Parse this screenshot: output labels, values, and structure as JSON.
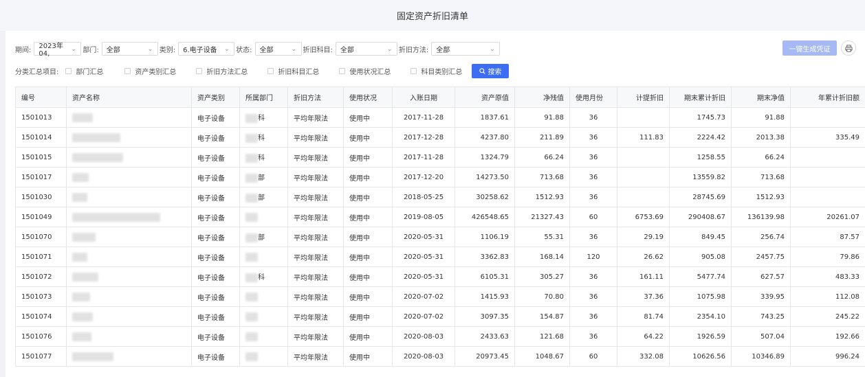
{
  "title": "固定资产折旧清单",
  "filters": {
    "period_label": "期间:",
    "period_value": "2023年04,",
    "dept_label": "部门:",
    "dept_value": "全部",
    "category_label": "类别:",
    "category_value": "6.电子设备",
    "status_label": "状态:",
    "status_value": "全部",
    "subject_label": "折旧科目:",
    "subject_value": "全部",
    "method_label": "折旧方法:",
    "method_value": "全部"
  },
  "buttons": {
    "generate": "一键生成凭证",
    "search": "搜索"
  },
  "summary": {
    "label": "分类汇总项目:",
    "options": [
      "部门汇总",
      "资产类别汇总",
      "折旧方法汇总",
      "折旧科目汇总",
      "使用状况汇总",
      "科目类别汇总"
    ]
  },
  "table": {
    "columns": [
      "编号",
      "资产名称",
      "资产类别",
      "所属部门",
      "折旧方法",
      "使用状况",
      "入账日期",
      "资产原值",
      "净残值",
      "使用月份",
      "计提折旧",
      "期末累计折旧",
      "期末净值",
      "年累计折旧额"
    ],
    "rows": [
      {
        "id": "1501013",
        "name_suffix": "",
        "category": "电子设备",
        "dept_suffix": "科",
        "method": "平均年限法",
        "status": "使用中",
        "date": "2017-11-28",
        "original": "1837.61",
        "residual": "91.88",
        "months": "36",
        "depr": "",
        "acc": "1745.73",
        "net": "91.88",
        "year": ""
      },
      {
        "id": "1501014",
        "name_suffix": "",
        "category": "电子设备",
        "dept_suffix": "科",
        "method": "平均年限法",
        "status": "使用中",
        "date": "2017-12-28",
        "original": "4237.80",
        "residual": "211.89",
        "months": "36",
        "depr": "111.83",
        "acc": "2224.42",
        "net": "2013.38",
        "year": "335.49"
      },
      {
        "id": "1501015",
        "name_suffix": "",
        "category": "电子设备",
        "dept_suffix": "科",
        "method": "平均年限法",
        "status": "使用中",
        "date": "2017-11-28",
        "original": "1324.79",
        "residual": "66.24",
        "months": "36",
        "depr": "",
        "acc": "1258.55",
        "net": "66.24",
        "year": ""
      },
      {
        "id": "1501017",
        "name_suffix": "",
        "category": "电子设备",
        "dept_suffix": "部",
        "method": "平均年限法",
        "status": "使用中",
        "date": "2017-12-20",
        "original": "14273.50",
        "residual": "713.68",
        "months": "36",
        "depr": "",
        "acc": "13559.82",
        "net": "713.68",
        "year": ""
      },
      {
        "id": "1501030",
        "name_suffix": "",
        "category": "电子设备",
        "dept_suffix": "部",
        "method": "平均年限法",
        "status": "使用中",
        "date": "2018-05-25",
        "original": "30258.62",
        "residual": "1512.93",
        "months": "36",
        "depr": "",
        "acc": "28745.69",
        "net": "1512.93",
        "year": ""
      },
      {
        "id": "1501049",
        "name_suffix": "",
        "category": "电子设备",
        "dept_suffix": "",
        "method": "平均年限法",
        "status": "使用中",
        "date": "2019-08-05",
        "original": "426548.65",
        "residual": "21327.43",
        "months": "60",
        "depr": "6753.69",
        "acc": "290408.67",
        "net": "136139.98",
        "year": "20261.07"
      },
      {
        "id": "1501070",
        "name_suffix": "",
        "category": "电子设备",
        "dept_suffix": "部",
        "method": "平均年限法",
        "status": "使用中",
        "date": "2020-05-31",
        "original": "1106.19",
        "residual": "55.31",
        "months": "36",
        "depr": "29.19",
        "acc": "849.45",
        "net": "256.74",
        "year": "87.57"
      },
      {
        "id": "1501071",
        "name_suffix": "",
        "category": "电子设备",
        "dept_suffix": "",
        "method": "平均年限法",
        "status": "使用中",
        "date": "2020-05-31",
        "original": "3362.83",
        "residual": "168.14",
        "months": "120",
        "depr": "26.62",
        "acc": "905.08",
        "net": "2457.75",
        "year": "79.86"
      },
      {
        "id": "1501072",
        "name_suffix": "",
        "category": "电子设备",
        "dept_suffix": "科",
        "method": "平均年限法",
        "status": "使用中",
        "date": "2020-05-31",
        "original": "6105.31",
        "residual": "305.27",
        "months": "36",
        "depr": "161.11",
        "acc": "5477.74",
        "net": "627.57",
        "year": "483.33"
      },
      {
        "id": "1501073",
        "name_suffix": "",
        "category": "电子设备",
        "dept_suffix": "",
        "method": "平均年限法",
        "status": "使用中",
        "date": "2020-07-02",
        "original": "1415.93",
        "residual": "70.80",
        "months": "36",
        "depr": "37.36",
        "acc": "1075.98",
        "net": "339.95",
        "year": "112.08"
      },
      {
        "id": "1501074",
        "name_suffix": "",
        "category": "电子设备",
        "dept_suffix": "",
        "method": "平均年限法",
        "status": "使用中",
        "date": "2020-07-02",
        "original": "3097.35",
        "residual": "154.87",
        "months": "36",
        "depr": "81.74",
        "acc": "2354.10",
        "net": "743.25",
        "year": "245.22"
      },
      {
        "id": "1501076",
        "name_suffix": "",
        "category": "电子设备",
        "dept_suffix": "",
        "method": "平均年限法",
        "status": "使用中",
        "date": "2020-08-03",
        "original": "2433.63",
        "residual": "121.68",
        "months": "36",
        "depr": "64.22",
        "acc": "1926.59",
        "net": "507.04",
        "year": "192.66"
      },
      {
        "id": "1501077",
        "name_suffix": "",
        "category": "电子设备",
        "dept_suffix": "",
        "method": "平均年限法",
        "status": "使用中",
        "date": "2020-08-03",
        "original": "20973.45",
        "residual": "1048.67",
        "months": "60",
        "depr": "332.08",
        "acc": "10626.56",
        "net": "10346.89",
        "year": "996.24"
      }
    ]
  },
  "colors": {
    "primary": "#3d6df2",
    "primary_disabled": "#a6b9f5",
    "header_bg": "#f7f8fa",
    "border": "#e6e6e6"
  }
}
